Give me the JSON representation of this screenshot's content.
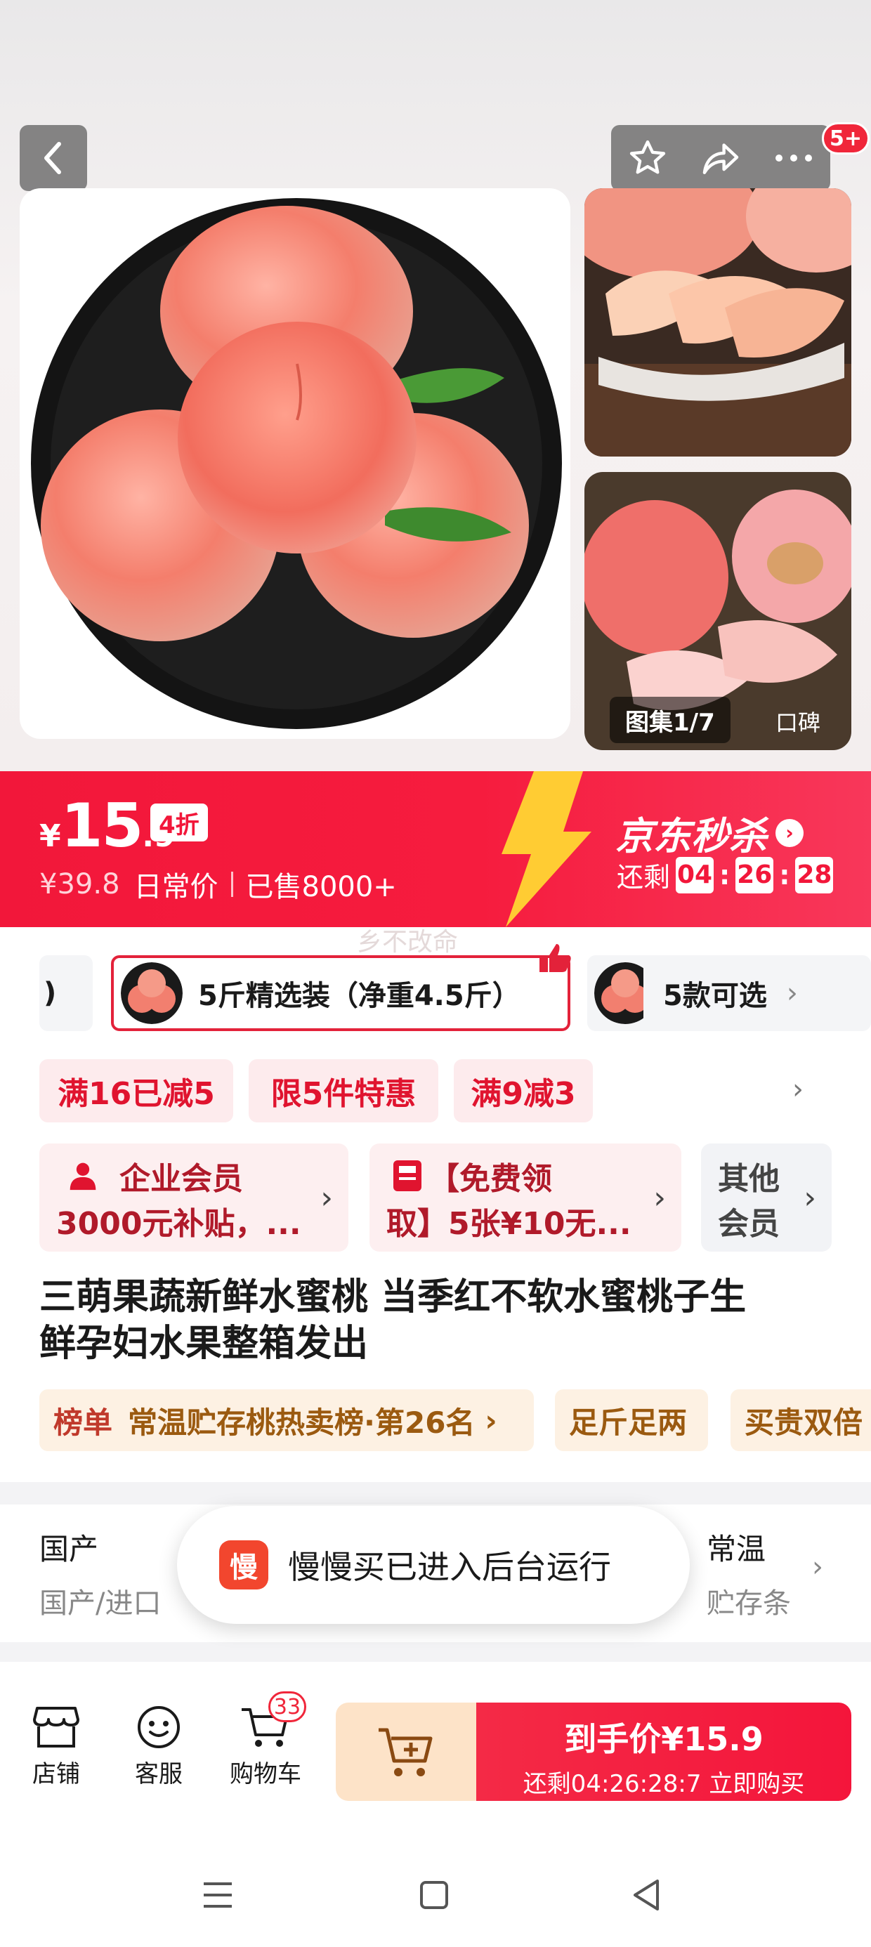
{
  "gallery": {
    "cart_count_badge": "5+",
    "album_label": "图集1/7",
    "review_label": "口碑"
  },
  "seckill": {
    "currency": "¥",
    "price_int": "15",
    "price_dec": ".9",
    "discount": "4折",
    "original_price": "¥39.8",
    "original_label": "日常价",
    "sold": "已售8000+",
    "channel_title": "京东秒杀",
    "remaining_label": "还剩",
    "countdown": [
      "04",
      "26",
      "28"
    ],
    "watermark": "乡不改命",
    "accent_color": "#f2173a"
  },
  "variants": {
    "prev_label": ")",
    "selected_label": "5斤精选装（净重4.5斤）",
    "more_label": "5款可选"
  },
  "promotions": [
    "满16已减5",
    "限5件特惠",
    "满9减3"
  ],
  "benefits": {
    "enterprise_line1": "企业会员",
    "enterprise_line2": "3000元补贴，...",
    "coupon_line1": "【免费领",
    "coupon_line2": "取】5张¥10无...",
    "other_line1": "其他",
    "other_line2": "会员"
  },
  "product": {
    "title_line1": "三萌果蔬新鲜水蜜桃 当季红不软水蜜桃子生",
    "title_line2": "鲜孕妇水果整箱发出",
    "rank_label": "榜单",
    "rank_text": "常温贮存桃热卖榜·第26名",
    "tag2": "足斤足两",
    "tag3": "买贵双倍"
  },
  "spec": {
    "origin_label": "国产",
    "origin_value": "国产/进口",
    "storage_label": "常温",
    "storage_value": "贮存条"
  },
  "toast": {
    "app_icon_text": "慢",
    "text": "慢慢买已进入后台运行"
  },
  "bottom_bar": {
    "shop_label": "店铺",
    "service_label": "客服",
    "cart_label": "购物车",
    "cart_count": "33",
    "buy_price": "到手价¥15.9",
    "buy_sub": "还剩04:26:28:7 立即购买"
  }
}
